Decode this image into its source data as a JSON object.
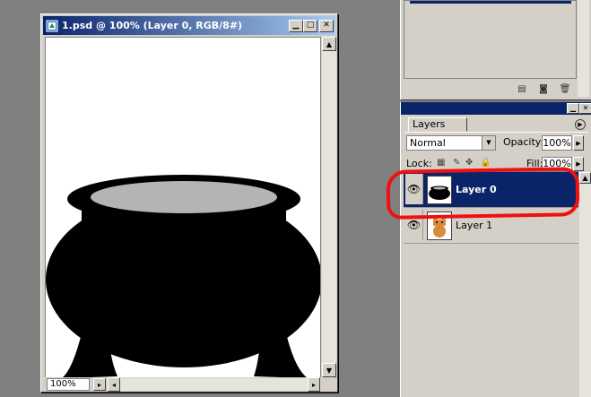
{
  "document": {
    "title": "1.psd @ 100% (Layer 0, RGB/8#)",
    "zoom": "100%",
    "canvas_colors": {
      "pot": "#000000",
      "rim_inner": "#b4b4b4",
      "background": "#ffffff"
    }
  },
  "layers_panel": {
    "tab_label": "Layers",
    "blend_mode": "Normal",
    "opacity_label": "Opacity:",
    "opacity_value": "100%",
    "lock_label": "Lock:",
    "fill_label": "Fill:",
    "fill_value": "100%",
    "layers": [
      {
        "name": "Layer 0",
        "selected": true,
        "thumb": "black-pot"
      },
      {
        "name": "Layer 1",
        "selected": false,
        "thumb": "cat-image"
      }
    ]
  },
  "icons": {
    "title_icon": "photoshop-doc-icon",
    "visibility": "eye-icon",
    "panel_menu": "panel-menu-arrow-icon"
  },
  "colors": {
    "titlebar_active": "#0a246a",
    "selection": "#0a246a",
    "annotation": "#ee1111",
    "chrome": "#d4d0c8",
    "workspace": "#808080"
  }
}
